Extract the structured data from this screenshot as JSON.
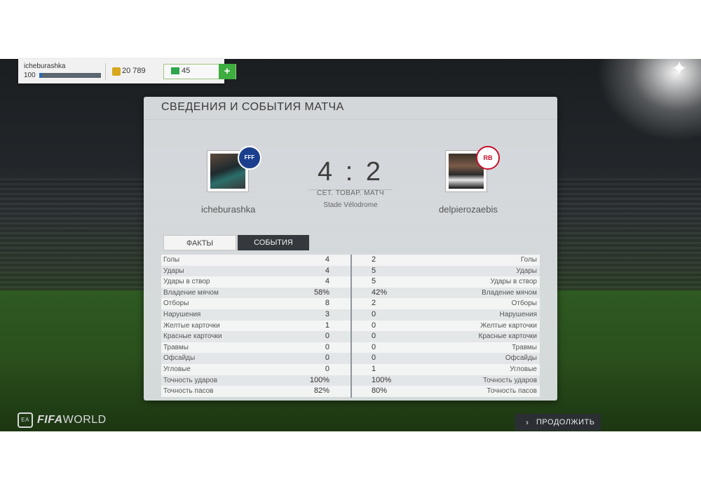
{
  "topbar": {
    "username": "icheburashka",
    "level": "100",
    "level_progress": 0.05,
    "coins": "20 789",
    "fifa_points": "45",
    "add_label": "+"
  },
  "panel": {
    "title": "СВЕДЕНИЯ И СОБЫТИЯ МАТЧА",
    "home_name": "icheburashka",
    "away_name": "delpierozaebis",
    "score": "4 : 2",
    "match_type": "СЕТ. ТОВАР. МАТЧ",
    "stadium": "Stade Vélodrome",
    "home_badge": "FFF",
    "away_badge": "RB"
  },
  "tabs": {
    "facts": "ФАКТЫ",
    "events": "СОБЫТИЯ"
  },
  "stats": [
    {
      "label": "Голы",
      "home": "4",
      "away": "2"
    },
    {
      "label": "Удары",
      "home": "4",
      "away": "5"
    },
    {
      "label": "Удары в створ",
      "home": "4",
      "away": "5"
    },
    {
      "label": "Владение мячом",
      "home": "58%",
      "away": "42%"
    },
    {
      "label": "Отборы",
      "home": "8",
      "away": "2"
    },
    {
      "label": "Нарушения",
      "home": "3",
      "away": "0"
    },
    {
      "label": "Желтые карточки",
      "home": "1",
      "away": "0"
    },
    {
      "label": "Красные карточки",
      "home": "0",
      "away": "0"
    },
    {
      "label": "Травмы",
      "home": "0",
      "away": "0"
    },
    {
      "label": "Офсайды",
      "home": "0",
      "away": "0"
    },
    {
      "label": "Угловые",
      "home": "0",
      "away": "1"
    },
    {
      "label": "Точность ударов",
      "home": "100%",
      "away": "100%"
    },
    {
      "label": "Точность пасов",
      "home": "82%",
      "away": "80%"
    }
  ],
  "footer": {
    "logo_prefix": "FIFA",
    "logo_suffix": "WORLD",
    "ea": "EA",
    "continue_label": "ПРОДОЛЖИТЬ",
    "continue_icon": "chevron-right-icon"
  }
}
